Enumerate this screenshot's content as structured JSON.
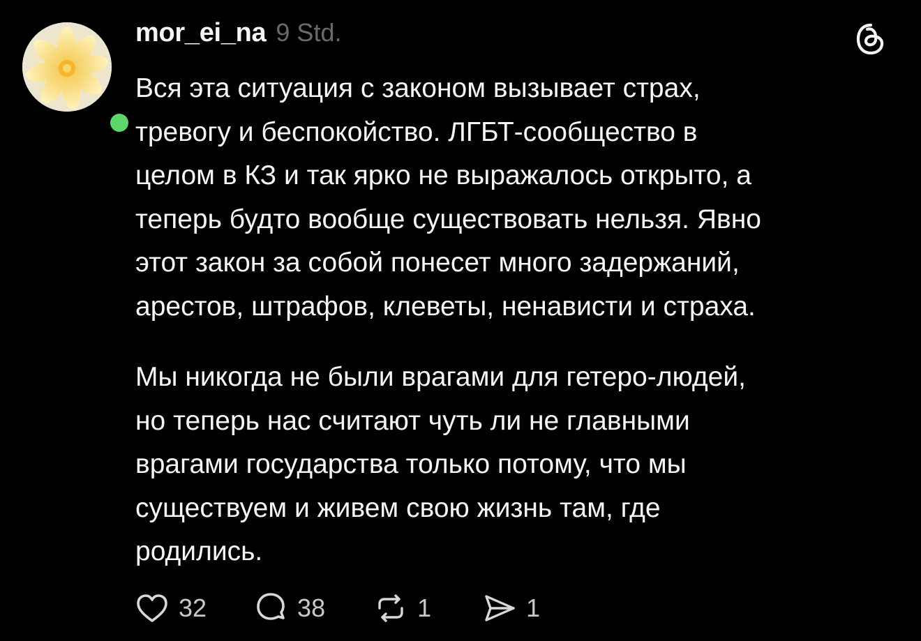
{
  "post": {
    "username": "mor_ei_na",
    "timestamp": "9 Std.",
    "paragraphs": [
      "Вся эта ситуация с законом вызывает страх,\nтревогу и беспокойство. ЛГБТ-сообщество в\nцелом в КЗ и так ярко не выражалось открыто, а\nтеперь будто вообще существовать нельзя. Явно\nэтот закон за собой понесет много задержаний,\nарестов, штрафов, клеветы, ненависти и страха.",
      "Мы никогда не были врагами для гетеро-людей,\nно теперь нас считают чуть ли не главными\nврагами государства только потому, что мы\nсуществуем и живем свою жизнь там, где\nродились."
    ],
    "actions": {
      "likes": "32",
      "replies": "38",
      "reposts": "1",
      "shares": "1"
    }
  },
  "icons": {
    "avatar": "yellow-flower-avatar",
    "online": "online-status-dot",
    "app": "threads-logo-icon",
    "like": "heart-icon",
    "reply": "speech-bubble-icon",
    "repost": "repost-arrows-icon",
    "share": "send-arrow-icon"
  },
  "colors": {
    "background": "#000000",
    "text": "#f3f5f7",
    "muted": "#6a6a6a",
    "online": "#5dd769"
  }
}
